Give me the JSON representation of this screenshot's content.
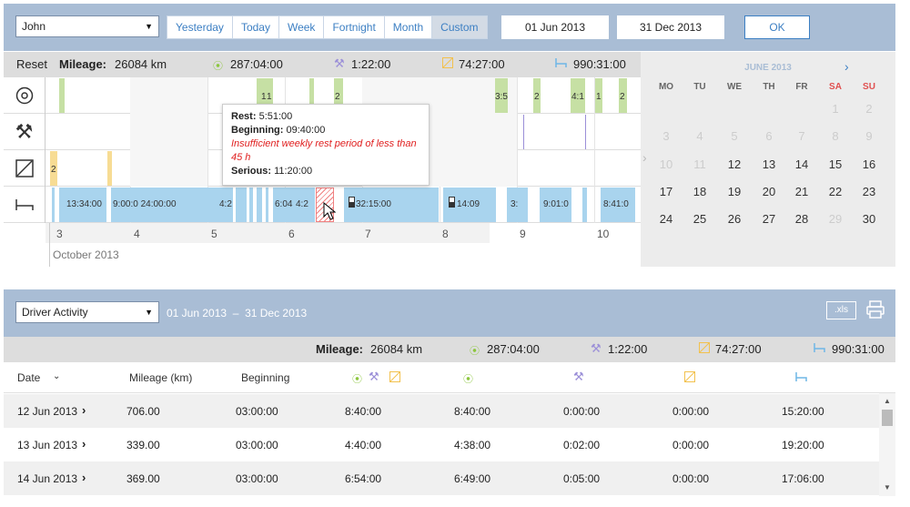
{
  "driver_select": {
    "value": "John"
  },
  "period_tabs": [
    "Yesterday",
    "Today",
    "Week",
    "Fortnight",
    "Month",
    "Custom"
  ],
  "period_active": "Custom",
  "date_from": "01 Jun 2013",
  "date_to": "31 Dec 2013",
  "ok_label": "OK",
  "summary": {
    "reset": "Reset",
    "mileage_label": "Mileage:",
    "mileage_value": "26084 km",
    "drive": "287:04:00",
    "work": "1:22:00",
    "available": "74:27:00",
    "rest": "990:31:00"
  },
  "timeline": {
    "green_labels": [
      "1",
      "1",
      "2",
      "3:5",
      "2",
      "4:1",
      "1",
      "2"
    ],
    "yellow_label": "2",
    "rest_labels": [
      "13:34:00",
      "9:00:0 24:00:00",
      "4:2",
      "6:04",
      "4:2",
      "32:15:00",
      "14:09",
      "3:",
      "9:01:0",
      "8:41:0"
    ],
    "ticks": [
      "3",
      "4",
      "5",
      "6",
      "7",
      "8",
      "9",
      "10"
    ],
    "month_label": "October 2013"
  },
  "tooltip": {
    "rest_label": "Rest:",
    "rest_value": "5:51:00",
    "beginning_label": "Beginning:",
    "beginning_value": "09:40:00",
    "warning": "Insufficient weekly rest period of less than 45 h",
    "serious_label": "Serious:",
    "serious_value": "11:20:00"
  },
  "calendar": {
    "month": "JUNE 2013",
    "dow": [
      "MO",
      "TU",
      "WE",
      "TH",
      "FR",
      "SA",
      "SU"
    ],
    "weekend_color": "#e05050",
    "rows": [
      [
        "",
        "",
        "",
        "",
        "",
        "1",
        "2"
      ],
      [
        "3",
        "4",
        "5",
        "6",
        "7",
        "8",
        "9"
      ],
      [
        "10",
        "11",
        "12",
        "13",
        "14",
        "15",
        "16"
      ],
      [
        "17",
        "18",
        "19",
        "20",
        "21",
        "22",
        "23"
      ],
      [
        "24",
        "25",
        "26",
        "27",
        "28",
        "29",
        "30"
      ]
    ]
  },
  "report": {
    "type": "Driver Activity",
    "range": "01 Jun 2013  –  31 Dec 2013",
    "xls": ".xls",
    "summary": {
      "mileage_label": "Mileage:",
      "mileage_value": "26084 km",
      "drive": "287:04:00",
      "work": "1:22:00",
      "available": "74:27:00",
      "rest": "990:31:00"
    },
    "columns": {
      "date": "Date",
      "mileage": "Mileage (km)",
      "beginning": "Beginning"
    },
    "rows": [
      {
        "date": "12 Jun 2013",
        "mileage": "706.00",
        "beginning": "03:00:00",
        "combined": "8:40:00",
        "drive": "8:40:00",
        "work": "0:00:00",
        "available": "0:00:00",
        "rest": "15:20:00"
      },
      {
        "date": "13 Jun 2013",
        "mileage": "339.00",
        "beginning": "03:00:00",
        "combined": "4:40:00",
        "drive": "4:38:00",
        "work": "0:02:00",
        "available": "0:00:00",
        "rest": "19:20:00"
      },
      {
        "date": "14 Jun 2013",
        "mileage": "369.00",
        "beginning": "03:00:00",
        "combined": "6:54:00",
        "drive": "6:49:00",
        "work": "0:05:00",
        "available": "0:00:00",
        "rest": "17:06:00"
      }
    ]
  },
  "colors": {
    "header_bg": "#a9bdd5",
    "accent": "#3c7fc3",
    "drive": "#8cc63e",
    "work": "#9b8fd8",
    "available": "#f2c14e",
    "rest": "#6fb7e6"
  },
  "icons": {
    "drive": "steering-wheel-icon",
    "work": "hammers-icon",
    "available": "slash-box-icon",
    "rest": "bed-icon"
  }
}
